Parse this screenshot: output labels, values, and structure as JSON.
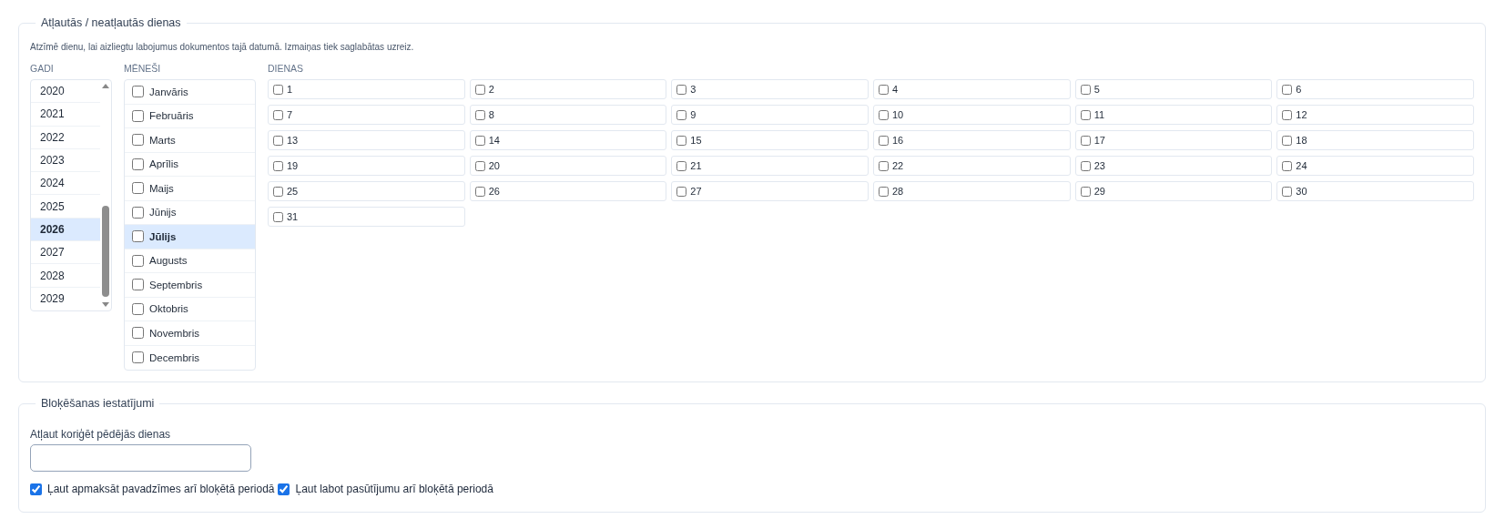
{
  "allowed_days": {
    "title": "Atļautās / neatļautās dienas",
    "hint": "Atzīmē dienu, lai aizliegtu labojumus dokumentos tajā datumā. Izmaiņas tiek saglabātas uzreiz.",
    "years": {
      "label": "GADI",
      "items": [
        {
          "label": "2020",
          "selected": false
        },
        {
          "label": "2021",
          "selected": false
        },
        {
          "label": "2022",
          "selected": false
        },
        {
          "label": "2023",
          "selected": false
        },
        {
          "label": "2024",
          "selected": false
        },
        {
          "label": "2025",
          "selected": false
        },
        {
          "label": "2026",
          "selected": true
        },
        {
          "label": "2027",
          "selected": false
        },
        {
          "label": "2028",
          "selected": false
        },
        {
          "label": "2029",
          "selected": false
        }
      ]
    },
    "months": {
      "label": "MĒNEŠI",
      "items": [
        {
          "label": "Janvāris",
          "checked": false,
          "selected": false
        },
        {
          "label": "Februāris",
          "checked": false,
          "selected": false
        },
        {
          "label": "Marts",
          "checked": false,
          "selected": false
        },
        {
          "label": "Aprīlis",
          "checked": false,
          "selected": false
        },
        {
          "label": "Maijs",
          "checked": false,
          "selected": false
        },
        {
          "label": "Jūnijs",
          "checked": false,
          "selected": false
        },
        {
          "label": "Jūlijs",
          "checked": false,
          "selected": true
        },
        {
          "label": "Augusts",
          "checked": false,
          "selected": false
        },
        {
          "label": "Septembris",
          "checked": false,
          "selected": false
        },
        {
          "label": "Oktobris",
          "checked": false,
          "selected": false
        },
        {
          "label": "Novembris",
          "checked": false,
          "selected": false
        },
        {
          "label": "Decembris",
          "checked": false,
          "selected": false
        }
      ]
    },
    "days": {
      "label": "DIENAS",
      "items": [
        {
          "label": "1",
          "checked": false
        },
        {
          "label": "2",
          "checked": false
        },
        {
          "label": "3",
          "checked": false
        },
        {
          "label": "4",
          "checked": false
        },
        {
          "label": "5",
          "checked": false
        },
        {
          "label": "6",
          "checked": false
        },
        {
          "label": "7",
          "checked": false
        },
        {
          "label": "8",
          "checked": false
        },
        {
          "label": "9",
          "checked": false
        },
        {
          "label": "10",
          "checked": false
        },
        {
          "label": "11",
          "checked": false
        },
        {
          "label": "12",
          "checked": false
        },
        {
          "label": "13",
          "checked": false
        },
        {
          "label": "14",
          "checked": false
        },
        {
          "label": "15",
          "checked": false
        },
        {
          "label": "16",
          "checked": false
        },
        {
          "label": "17",
          "checked": false
        },
        {
          "label": "18",
          "checked": false
        },
        {
          "label": "19",
          "checked": false
        },
        {
          "label": "20",
          "checked": false
        },
        {
          "label": "21",
          "checked": false
        },
        {
          "label": "22",
          "checked": false
        },
        {
          "label": "23",
          "checked": false
        },
        {
          "label": "24",
          "checked": false
        },
        {
          "label": "25",
          "checked": false
        },
        {
          "label": "26",
          "checked": false
        },
        {
          "label": "27",
          "checked": false
        },
        {
          "label": "28",
          "checked": false
        },
        {
          "label": "29",
          "checked": false
        },
        {
          "label": "30",
          "checked": false
        },
        {
          "label": "31",
          "checked": false
        }
      ]
    }
  },
  "blocking_settings": {
    "title": "Bloķēšanas iestatījumi",
    "field": {
      "label": "Atļaut koriģēt pēdējās dienas"
    },
    "options": [
      {
        "label": "Ļaut apmaksāt pavadzīmes arī bloķētā periodā",
        "checked": true
      },
      {
        "label": "Ļaut labot pasūtījumu arī bloķētā periodā",
        "checked": true
      }
    ]
  }
}
